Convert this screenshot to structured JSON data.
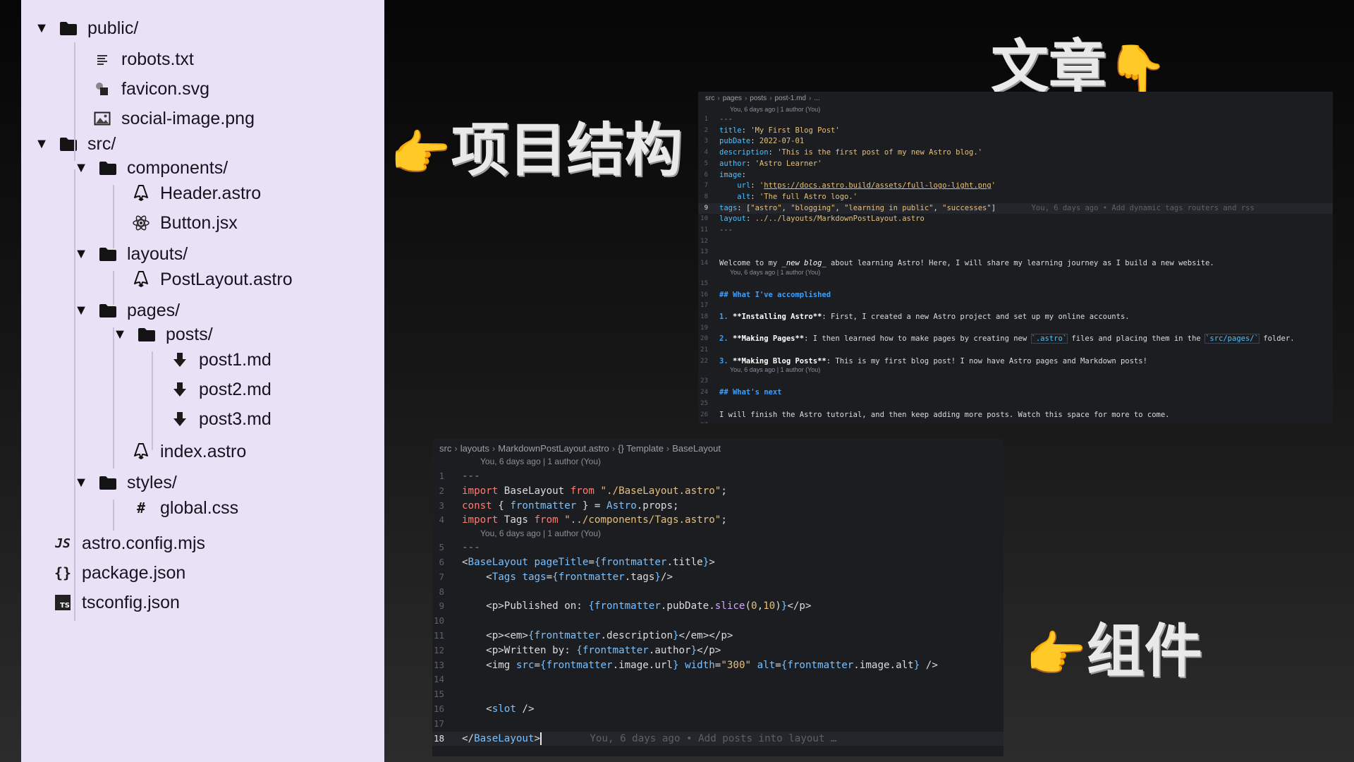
{
  "file_tree": [
    {
      "label": "public/",
      "kind": "folder",
      "expanded": true,
      "depth": 0,
      "icon": "folder-icon"
    },
    {
      "label": "robots.txt",
      "kind": "file",
      "depth": 1,
      "icon": "text-file-icon"
    },
    {
      "label": "favicon.svg",
      "kind": "file",
      "depth": 1,
      "icon": "svg-file-icon"
    },
    {
      "label": "social-image.png",
      "kind": "file",
      "depth": 1,
      "icon": "image-file-icon"
    },
    {
      "label": "src/",
      "kind": "folder",
      "expanded": true,
      "depth": 0,
      "icon": "folder-icon"
    },
    {
      "label": "components/",
      "kind": "folder",
      "expanded": true,
      "depth": 1,
      "icon": "folder-icon"
    },
    {
      "label": "Header.astro",
      "kind": "file",
      "depth": 2,
      "icon": "astro-icon"
    },
    {
      "label": "Button.jsx",
      "kind": "file",
      "depth": 2,
      "icon": "react-icon"
    },
    {
      "label": "layouts/",
      "kind": "folder",
      "expanded": true,
      "depth": 1,
      "icon": "folder-icon"
    },
    {
      "label": "PostLayout.astro",
      "kind": "file",
      "depth": 2,
      "icon": "astro-icon"
    },
    {
      "label": "pages/",
      "kind": "folder",
      "expanded": true,
      "depth": 1,
      "icon": "folder-icon"
    },
    {
      "label": "posts/",
      "kind": "folder",
      "expanded": true,
      "depth": 2,
      "icon": "folder-icon"
    },
    {
      "label": "post1.md",
      "kind": "file",
      "depth": 3,
      "icon": "markdown-icon"
    },
    {
      "label": "post2.md",
      "kind": "file",
      "depth": 3,
      "icon": "markdown-icon"
    },
    {
      "label": "post3.md",
      "kind": "file",
      "depth": 3,
      "icon": "markdown-icon"
    },
    {
      "label": "index.astro",
      "kind": "file",
      "depth": 2,
      "icon": "astro-icon"
    },
    {
      "label": "styles/",
      "kind": "folder",
      "expanded": true,
      "depth": 1,
      "icon": "folder-icon"
    },
    {
      "label": "global.css",
      "kind": "file",
      "depth": 2,
      "icon": "css-icon"
    },
    {
      "label": "astro.config.mjs",
      "kind": "file",
      "depth": 0,
      "icon": "js-icon"
    },
    {
      "label": "package.json",
      "kind": "file",
      "depth": 0,
      "icon": "json-icon"
    },
    {
      "label": "tsconfig.json",
      "kind": "file",
      "depth": 0,
      "icon": "ts-icon"
    }
  ],
  "headings": {
    "article": {
      "text": "文章",
      "icon": "pointing-down-hand-icon",
      "glyph": "👇"
    },
    "structure": {
      "text": "项目结构",
      "icon": "pointing-right-hand-icon",
      "glyph": "👉"
    },
    "component": {
      "text": "组件",
      "icon": "pointing-right-hand-icon",
      "glyph": "👉"
    }
  },
  "markdown_editor": {
    "breadcrumb": [
      "src",
      "pages",
      "posts",
      "post-1.md",
      "..."
    ],
    "blame_top": "You, 6 days ago | 1 author (You)",
    "blame_mid_1": "You, 6 days ago | 1 author (You)",
    "blame_mid_2": "You, 6 days ago | 1 author (You)",
    "active_line": 9,
    "inline_blame": "You, 6 days ago • Add dynamic tags routers and rss",
    "lines": [
      [
        [
          "t-dim",
          "---"
        ]
      ],
      [
        [
          "t-key",
          "title"
        ],
        [
          "t-plain",
          ": "
        ],
        [
          "t-str",
          "'My First Blog Post'"
        ]
      ],
      [
        [
          "t-key",
          "pubDate"
        ],
        [
          "t-plain",
          ": "
        ],
        [
          "t-num",
          "2022-07-01"
        ]
      ],
      [
        [
          "t-key",
          "description"
        ],
        [
          "t-plain",
          ": "
        ],
        [
          "t-str",
          "'This is the first post of my new Astro blog.'"
        ]
      ],
      [
        [
          "t-key",
          "author"
        ],
        [
          "t-plain",
          ": "
        ],
        [
          "t-str",
          "'Astro Learner'"
        ]
      ],
      [
        [
          "t-key",
          "image"
        ],
        [
          "t-plain",
          ":"
        ]
      ],
      [
        [
          "t-plain",
          "    "
        ],
        [
          "t-key",
          "url"
        ],
        [
          "t-plain",
          ": "
        ],
        [
          "t-str",
          "'"
        ],
        [
          "t-link",
          "https://docs.astro.build/assets/full-logo-light.png"
        ],
        [
          "t-str",
          "'"
        ]
      ],
      [
        [
          "t-plain",
          "    "
        ],
        [
          "t-key",
          "alt"
        ],
        [
          "t-plain",
          ": "
        ],
        [
          "t-str",
          "'The full Astro logo.'"
        ]
      ],
      [
        [
          "t-key",
          "tags"
        ],
        [
          "t-plain",
          ": ["
        ],
        [
          "t-str",
          "\"astro\""
        ],
        [
          "t-plain",
          ", "
        ],
        [
          "t-str",
          "\"blogging\""
        ],
        [
          "t-plain",
          ", "
        ],
        [
          "t-str",
          "\"learning in public\""
        ],
        [
          "t-plain",
          ", "
        ],
        [
          "t-str",
          "\"successes\""
        ],
        [
          "t-plain",
          "]"
        ]
      ],
      [
        [
          "t-key",
          "layout"
        ],
        [
          "t-plain",
          ": "
        ],
        [
          "t-str",
          "../../layouts/MarkdownPostLayout.astro"
        ]
      ],
      [
        [
          "t-dim",
          "---"
        ]
      ],
      [],
      [],
      [
        [
          "t-plain",
          "Welcome to my "
        ],
        [
          "t-em",
          "_new blog_"
        ],
        [
          "t-plain",
          " about learning Astro! Here, I will share my learning journey as I build a new website."
        ]
      ],
      [],
      [
        [
          "t-head",
          "## What I've accomplished"
        ]
      ],
      [],
      [
        [
          "t-head",
          "1. "
        ],
        [
          "t-bold",
          "**Installing Astro**"
        ],
        [
          "t-plain",
          ": First, I created a new Astro project and set up my online accounts."
        ]
      ],
      [],
      [
        [
          "t-head",
          "2. "
        ],
        [
          "t-bold",
          "**Making Pages**"
        ],
        [
          "t-plain",
          ": I then learned how to make pages by creating new "
        ],
        [
          "t-code",
          "`.astro`"
        ],
        [
          "t-plain",
          " files and placing them in the "
        ],
        [
          "t-code",
          "`src/pages/`"
        ],
        [
          "t-plain",
          " folder."
        ]
      ],
      [],
      [
        [
          "t-head",
          "3. "
        ],
        [
          "t-bold",
          "**Making Blog Posts**"
        ],
        [
          "t-plain",
          ": This is my first blog post! I now have Astro pages and Markdown posts!"
        ]
      ],
      [],
      [
        [
          "t-head",
          "## What's next"
        ]
      ],
      [],
      [
        [
          "t-plain",
          "I will finish the Astro tutorial, and then keep adding more posts. Watch this space for more to come."
        ]
      ],
      []
    ]
  },
  "layout_editor": {
    "breadcrumb": [
      "src",
      "layouts",
      "MarkdownPostLayout.astro",
      "{} Template",
      "BaseLayout"
    ],
    "blame_top": "You, 6 days ago | 1 author (You)",
    "blame_mid": "You, 6 days ago | 1 author (You)",
    "active_line": 18,
    "inline_blame": "You, 6 days ago • Add posts into layout …",
    "lines": [
      [
        [
          "t-dim",
          "---"
        ]
      ],
      [
        [
          "t-kw",
          "import"
        ],
        [
          "t-plain",
          " BaseLayout "
        ],
        [
          "t-kw",
          "from"
        ],
        [
          "t-plain",
          " "
        ],
        [
          "t-str",
          "\"./BaseLayout.astro\""
        ],
        [
          "t-plain",
          ";"
        ]
      ],
      [
        [
          "t-kw",
          "const"
        ],
        [
          "t-plain",
          " { "
        ],
        [
          "t-var",
          "frontmatter"
        ],
        [
          "t-plain",
          " } = "
        ],
        [
          "t-var",
          "Astro"
        ],
        [
          "t-plain",
          ".props;"
        ]
      ],
      [
        [
          "t-kw",
          "import"
        ],
        [
          "t-plain",
          " Tags "
        ],
        [
          "t-kw",
          "from"
        ],
        [
          "t-plain",
          " "
        ],
        [
          "t-str",
          "\"../components/Tags.astro\""
        ],
        [
          "t-plain",
          ";"
        ]
      ],
      [
        [
          "t-dim",
          "---"
        ]
      ],
      [
        [
          "t-plain",
          "<"
        ],
        [
          "t-tag",
          "BaseLayout"
        ],
        [
          "t-plain",
          " "
        ],
        [
          "t-attr",
          "pageTitle"
        ],
        [
          "t-plain",
          "="
        ],
        [
          "t-brace",
          "{"
        ],
        [
          "t-var",
          "frontmatter"
        ],
        [
          "t-plain",
          ".title"
        ],
        [
          "t-brace",
          "}"
        ],
        [
          "t-plain",
          ">"
        ]
      ],
      [
        [
          "t-plain",
          "    <"
        ],
        [
          "t-tag",
          "Tags"
        ],
        [
          "t-plain",
          " "
        ],
        [
          "t-attr",
          "tags"
        ],
        [
          "t-plain",
          "="
        ],
        [
          "t-brace",
          "{"
        ],
        [
          "t-var",
          "frontmatter"
        ],
        [
          "t-plain",
          ".tags"
        ],
        [
          "t-brace",
          "}"
        ],
        [
          "t-plain",
          "/>"
        ]
      ],
      [],
      [
        [
          "t-plain",
          "    <p>Published on: "
        ],
        [
          "t-brace",
          "{"
        ],
        [
          "t-var",
          "frontmatter"
        ],
        [
          "t-plain",
          ".pubDate."
        ],
        [
          "t-fn",
          "slice"
        ],
        [
          "t-plain",
          "("
        ],
        [
          "t-num",
          "0"
        ],
        [
          "t-plain",
          ","
        ],
        [
          "t-num",
          "10"
        ],
        [
          "t-plain",
          ")"
        ],
        [
          "t-brace",
          "}"
        ],
        [
          "t-plain",
          "</p>"
        ]
      ],
      [],
      [
        [
          "t-plain",
          "    <p><em>"
        ],
        [
          "t-brace",
          "{"
        ],
        [
          "t-var",
          "frontmatter"
        ],
        [
          "t-plain",
          ".description"
        ],
        [
          "t-brace",
          "}"
        ],
        [
          "t-plain",
          "</em></p>"
        ]
      ],
      [
        [
          "t-plain",
          "    <p>Written by: "
        ],
        [
          "t-brace",
          "{"
        ],
        [
          "t-var",
          "frontmatter"
        ],
        [
          "t-plain",
          ".author"
        ],
        [
          "t-brace",
          "}"
        ],
        [
          "t-plain",
          "</p>"
        ]
      ],
      [
        [
          "t-plain",
          "    <img "
        ],
        [
          "t-attr",
          "src"
        ],
        [
          "t-plain",
          "="
        ],
        [
          "t-brace",
          "{"
        ],
        [
          "t-var",
          "frontmatter"
        ],
        [
          "t-plain",
          ".image.url"
        ],
        [
          "t-brace",
          "}"
        ],
        [
          "t-plain",
          " "
        ],
        [
          "t-attr",
          "width"
        ],
        [
          "t-plain",
          "="
        ],
        [
          "t-str",
          "\"300\""
        ],
        [
          "t-plain",
          " "
        ],
        [
          "t-attr",
          "alt"
        ],
        [
          "t-plain",
          "="
        ],
        [
          "t-brace",
          "{"
        ],
        [
          "t-var",
          "frontmatter"
        ],
        [
          "t-plain",
          ".image.alt"
        ],
        [
          "t-brace",
          "}"
        ],
        [
          "t-plain",
          " />"
        ]
      ],
      [],
      [],
      [
        [
          "t-plain",
          "    <"
        ],
        [
          "t-tag",
          "slot"
        ],
        [
          "t-plain",
          " />"
        ]
      ],
      [],
      [
        [
          "t-plain",
          "</"
        ],
        [
          "t-tag",
          "BaseLayout"
        ],
        [
          "t-plain",
          ">"
        ]
      ]
    ]
  }
}
